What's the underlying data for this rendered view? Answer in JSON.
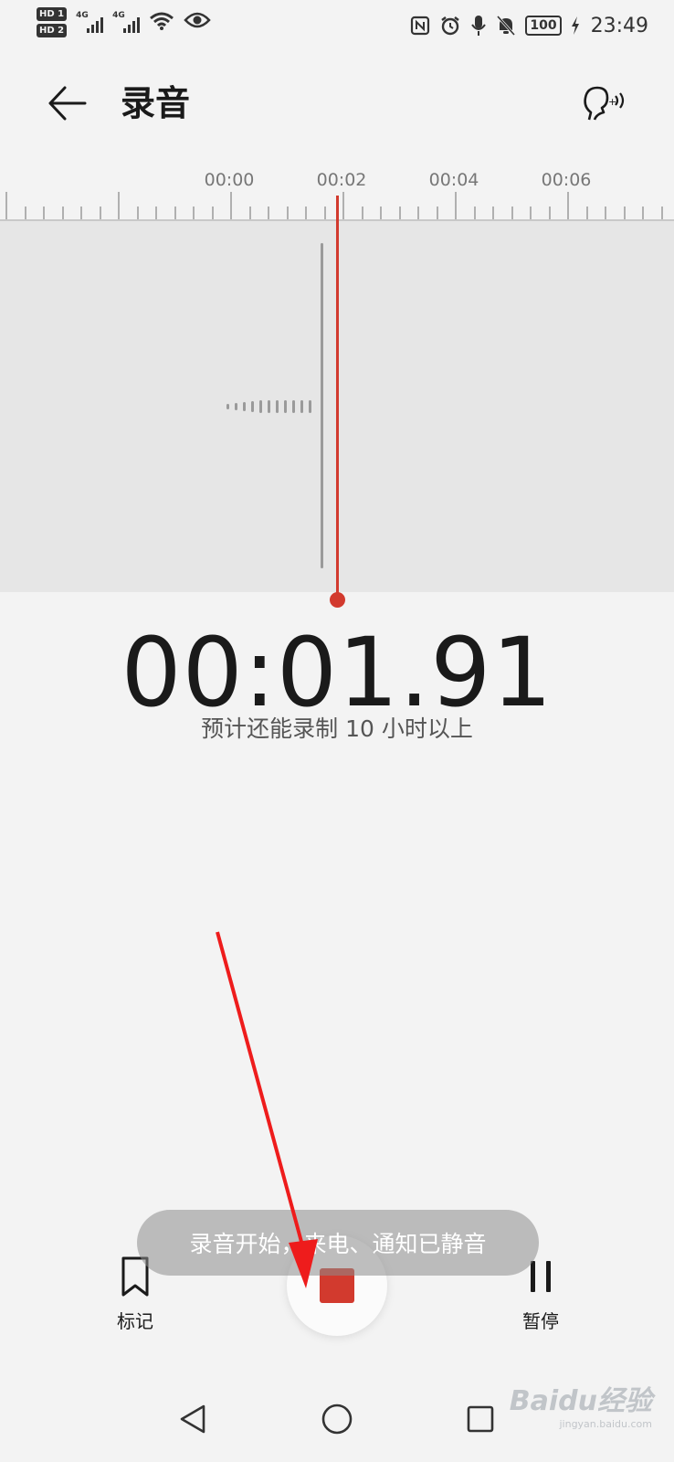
{
  "status_bar": {
    "hd1": "HD 1",
    "hd2": "HD 2",
    "network1": "4G",
    "network2": "4G",
    "battery": "100",
    "time": "23:49",
    "icons": [
      "nfc-icon",
      "alarm-icon",
      "mic-icon",
      "mute-icon",
      "charging-icon"
    ]
  },
  "header": {
    "title": "录音",
    "back_icon": "arrow-left-icon",
    "voice_icon": "voice-assistant-icon"
  },
  "timeline": {
    "labels": [
      "00:00",
      "00:02",
      "00:04",
      "00:06"
    ]
  },
  "recording": {
    "elapsed": "00:01.91",
    "remaining_text": "预计还能录制 10 小时以上"
  },
  "controls": {
    "mark_label": "标记",
    "pause_label": "暂停",
    "stop_icon": "stop-icon"
  },
  "toast": {
    "message": "录音开始，来电、通知已静音"
  },
  "watermark": {
    "brand": "Baidu经验",
    "url": "jingyan.baidu.com"
  },
  "colors": {
    "accent": "#d23a2e",
    "background": "#f3f3f3",
    "wave_bg": "#e6e6e6"
  }
}
